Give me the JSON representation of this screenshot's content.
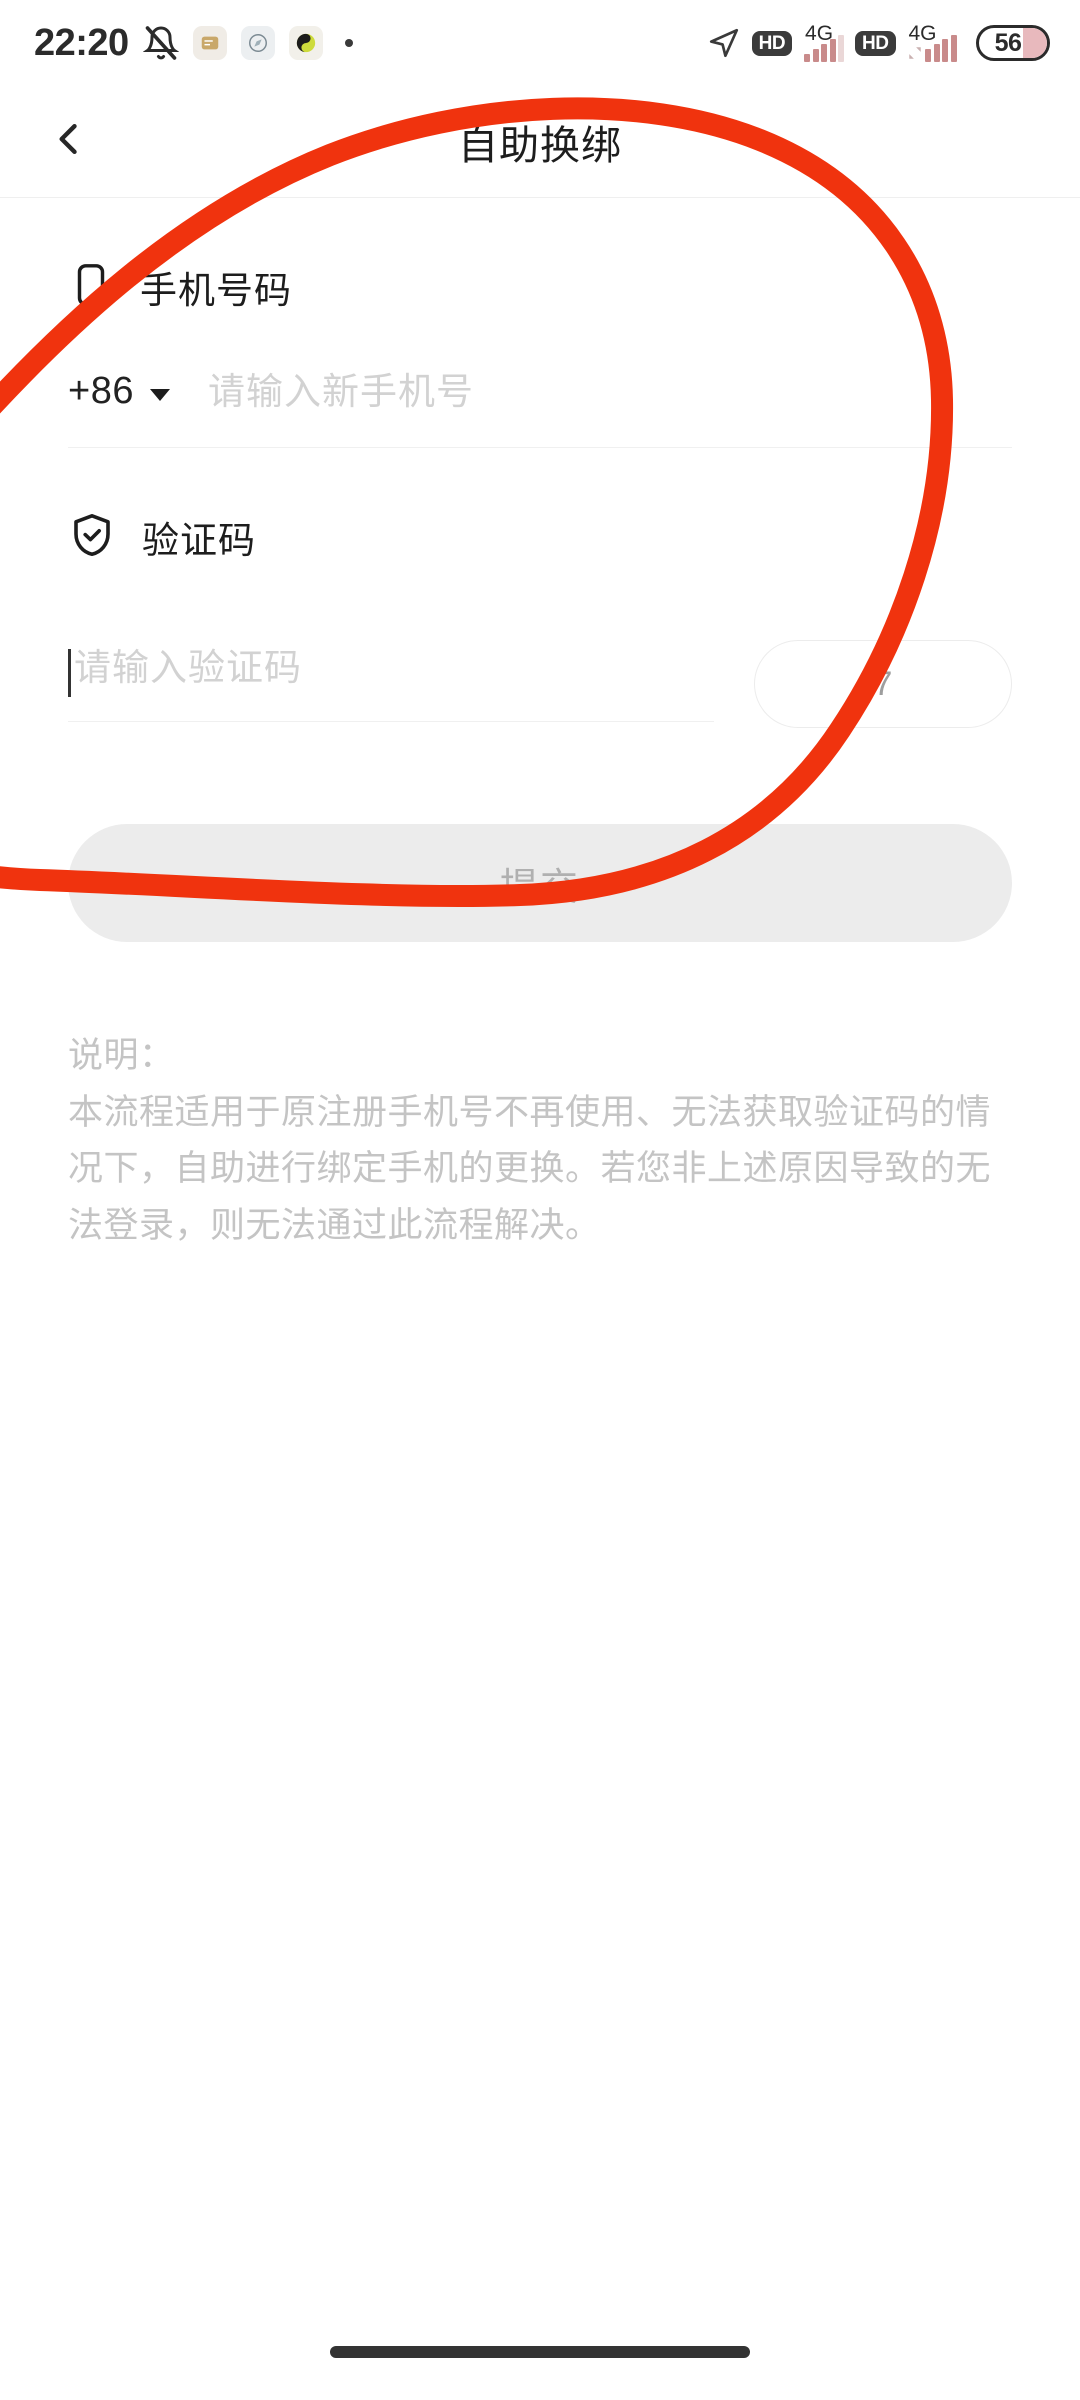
{
  "status_bar": {
    "time": "22:20",
    "mute_icon": "bell-muted-icon",
    "app_icons": [
      "notes-app-icon",
      "navigation-app-icon",
      "media-app-icon"
    ],
    "overflow_dot": "·",
    "location_icon": "location-arrow-icon",
    "sim1": {
      "hd_label": "HD",
      "network": "4G",
      "signal_bars": 4
    },
    "sim2": {
      "hd_label": "HD",
      "network": "4G",
      "signal_bars": 5
    },
    "battery": {
      "level": "56",
      "percent": 56
    }
  },
  "header": {
    "back_icon": "chevron-left-icon",
    "title": "自助换绑"
  },
  "form": {
    "phone_section": {
      "icon": "mobile-phone-icon",
      "label": "手机号码",
      "country_code": "+86",
      "dropdown_icon": "caret-down-icon",
      "input_value": "",
      "input_placeholder": "请输入新手机号"
    },
    "code_section": {
      "icon": "shield-check-icon",
      "label": "验证码",
      "input_value": "",
      "input_placeholder": "请输入验证码",
      "countdown_label": "7"
    },
    "submit_label": "提交",
    "submit_disabled": true
  },
  "notes": {
    "heading": "说明：",
    "body": "本流程适用于原注册手机号不再使用、无法获取验证码的情况下，自助进行绑定手机的更换。若您非上述原因导致的无法登录，则无法通过此流程解决。"
  },
  "annotation": {
    "type": "hand-drawn-circle",
    "color": "#F0330E",
    "stroke_width": 22
  },
  "system": {
    "home_indicator": "gesture-home-bar"
  }
}
